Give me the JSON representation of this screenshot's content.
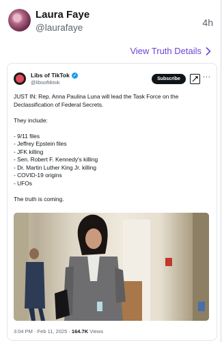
{
  "post": {
    "display_name": "Laura Faye",
    "handle": "@laurafaye",
    "time": "4h",
    "view_link": "View Truth Details"
  },
  "embedded_tweet": {
    "name": "Libs of TikTok",
    "handle": "@libsoftiktok",
    "subscribe_label": "Subscribe",
    "more_label": "···",
    "lines": [
      "JUST IN: Rep. Anna Paulina Luna will lead the Task Force on the Declassification of Federal Secrets.",
      "They include:",
      "- 9/11 files",
      "- Jeffrey Epstein files",
      "- JFK killing",
      "- Sen. Robert F. Kennedy's killing",
      "- Dr. Martin Luther King Jr. killing",
      "- COVID-19 origins",
      "- UFOs",
      "The truth is coming."
    ],
    "timestamp": "3:04 PM · Feb 11, 2025 ·",
    "views_count": "164.7K",
    "views_label": "Views"
  },
  "colors": {
    "link": "#6a44d6",
    "verified": "#1d9bf0"
  }
}
